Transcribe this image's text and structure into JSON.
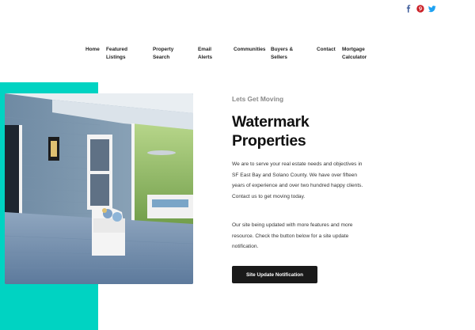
{
  "social": {
    "icons": [
      {
        "name": "facebook",
        "color": "#3b5998"
      },
      {
        "name": "pinterest",
        "color": "#cb2027"
      },
      {
        "name": "twitter",
        "color": "#1da1f2"
      }
    ]
  },
  "nav": {
    "items": [
      {
        "label": "Home"
      },
      {
        "label": "Featured Listings"
      },
      {
        "label": "Property Search"
      },
      {
        "label": "Email Alerts"
      },
      {
        "label": "Communities"
      },
      {
        "label": "Buyers & Sellers"
      },
      {
        "label": "Contact"
      },
      {
        "label": "Mortgage Calculator"
      }
    ]
  },
  "colors": {
    "accent": "#00d3c2",
    "button_bg": "#1a1a1a"
  },
  "hero": {
    "eyebrow": "Lets Get Moving",
    "title": "Watermark Properties",
    "paragraph1": "We are to serve your real estate needs and objectives in SF East Bay and Solano County.  We have over fifteen years of experience and over two hundred happy clients.  Contact us to get moving today.",
    "paragraph2": "Our site being updated with more features and more resource.  Check the button below for a site update notification.",
    "button_label": "Site Update Notification"
  }
}
